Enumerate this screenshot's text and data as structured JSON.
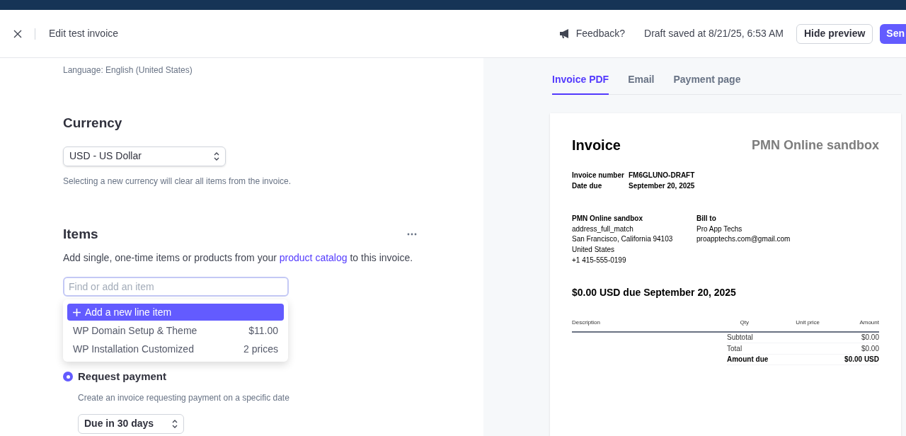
{
  "header": {
    "title": "Edit test invoice",
    "feedback": "Feedback?",
    "draft_status": "Draft saved at 8/21/25, 6:53 AM",
    "hide_preview_button": "Hide preview",
    "send_button": "Sen"
  },
  "editor": {
    "language": "Language: English (United States)",
    "currency": {
      "heading": "Currency",
      "select_value": "USD - US Dollar",
      "note": "Selecting a new currency will clear all items from the invoice."
    },
    "items": {
      "heading": "Items",
      "description": "Add single, one-time items or products from your ",
      "catalog_link": "product catalog",
      "description_end": " to this invoice.",
      "search": {
        "placeholder": "Find or add an item"
      },
      "dropdown": [
        {
          "kind": "add",
          "label": "Add a new line item",
          "highlighted": true
        },
        {
          "kind": "product",
          "label": "WP Domain Setup & Theme",
          "price": "$11.00",
          "highlighted": false
        },
        {
          "kind": "product",
          "label": "WP Installation Customized",
          "price": "2 prices",
          "highlighted": false
        }
      ]
    },
    "payment": {
      "options": [
        {
          "label": "Request payment",
          "description": "Create an invoice requesting payment on a specific date",
          "selected": true
        }
      ],
      "due_select": "Due in 30 days"
    }
  },
  "preview": {
    "tabs": [
      {
        "label": "Invoice PDF",
        "selected": true
      },
      {
        "label": "Email",
        "selected": false
      },
      {
        "label": "Payment page",
        "selected": false
      }
    ],
    "invoice": {
      "title": "Invoice",
      "company": "PMN Online sandbox",
      "meta": [
        {
          "label": "Invoice number",
          "value": "FM6GLUNO-DRAFT"
        },
        {
          "label": "Date due",
          "value": "September 20, 2025"
        }
      ],
      "from": {
        "heading": "PMN Online sandbox",
        "lines": [
          "address_full_match",
          "San Francisco, California 94103",
          "United States",
          "+1 415-555-0199"
        ]
      },
      "bill_to": {
        "heading": "Bill to",
        "lines": [
          "Pro App Techs",
          "proapptechs.com@gmail.com"
        ]
      },
      "amount_due_heading": "$0.00 USD due September 20, 2025",
      "columns": [
        "Description",
        "Qty",
        "Unit price",
        "Amount"
      ],
      "totals": [
        {
          "label": "Subtotal",
          "value": "$0.00",
          "bold": false
        },
        {
          "label": "Total",
          "value": "$0.00",
          "bold": false
        },
        {
          "label": "Amount due",
          "value": "$0.00 USD",
          "bold": true
        }
      ]
    }
  }
}
